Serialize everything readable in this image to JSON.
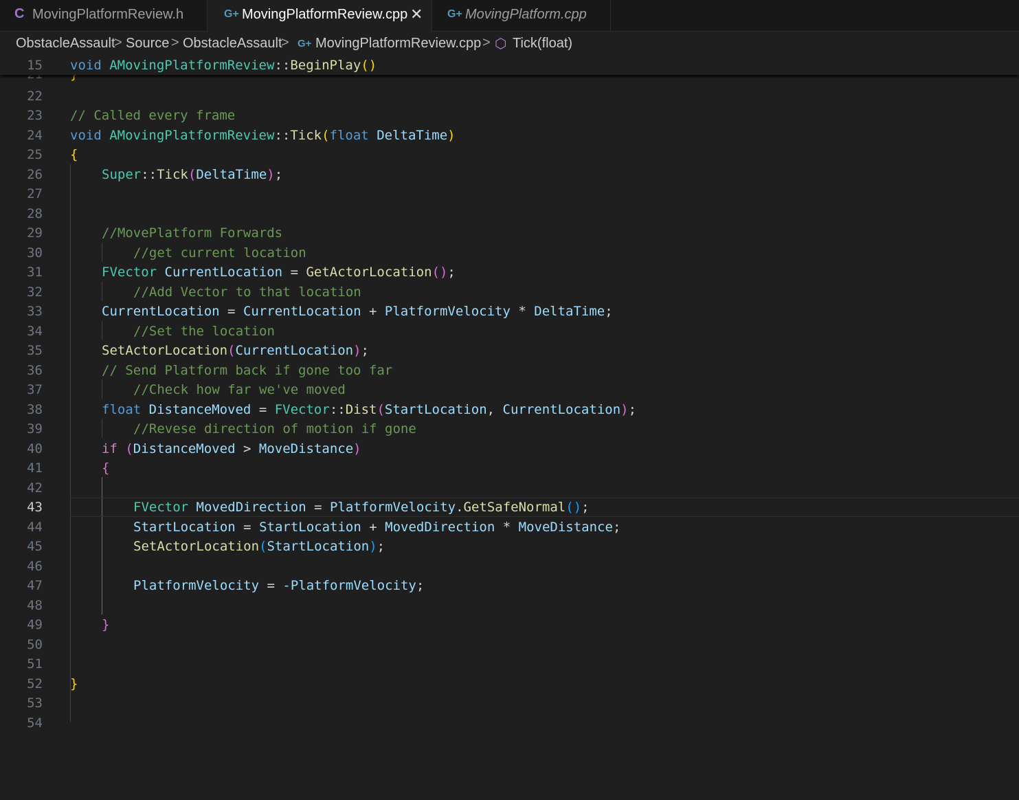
{
  "tabs": [
    {
      "label": "MovingPlatformReview.h",
      "icon": "C",
      "icon_name": "c-header-icon",
      "active": false
    },
    {
      "label": "MovingPlatformReview.cpp",
      "icon": "G+",
      "icon_name": "cpp-file-icon",
      "active": true,
      "close": "✕"
    },
    {
      "label": "MovingPlatform.cpp",
      "icon": "G+",
      "icon_name": "cpp-file-icon",
      "active": false
    }
  ],
  "breadcrumb": {
    "items": [
      "ObstacleAssault",
      "Source",
      "ObstacleAssault",
      "MovingPlatformReview.cpp",
      "Tick(float)"
    ],
    "separator": ">"
  },
  "editor": {
    "current_line": "43",
    "sticky": {
      "number": "15",
      "t1": "void",
      "t2": "AMovingPlatformReview",
      "t3": "::",
      "t4": "BeginPlay",
      "t5": "()"
    },
    "partial_line": {
      "number": "21",
      "text": "}"
    },
    "lines": [
      {
        "number": "22"
      },
      {
        "number": "23",
        "t1": "// Called every frame"
      },
      {
        "number": "24",
        "t1": "void",
        "t2": "AMovingPlatformReview",
        "t3": "::",
        "t4": "Tick",
        "t5": "(",
        "t6": "float",
        "t7": "DeltaTime",
        "t8": ")"
      },
      {
        "number": "25",
        "t1": "{"
      },
      {
        "number": "26",
        "t1": "Super",
        "t2": "::",
        "t3": "Tick",
        "t4": "(",
        "t5": "DeltaTime",
        "t6": ")",
        "t7": ";"
      },
      {
        "number": "27"
      },
      {
        "number": "28"
      },
      {
        "number": "29",
        "t1": "//MovePlatform Forwards"
      },
      {
        "number": "30",
        "t1": "//get current location"
      },
      {
        "number": "31",
        "t1": "FVector",
        "t2": "CurrentLocation",
        "t3": "=",
        "t4": "GetActorLocation",
        "t5": "()",
        "t6": ";"
      },
      {
        "number": "32",
        "t1": "//Add Vector to that location"
      },
      {
        "number": "33",
        "t1": "CurrentLocation",
        "t2": "=",
        "t3": "CurrentLocation",
        "t4": "+",
        "t5": "PlatformVelocity",
        "t6": "*",
        "t7": "DeltaTime",
        "t8": ";"
      },
      {
        "number": "34",
        "t1": "//Set the location"
      },
      {
        "number": "35",
        "t1": "SetActorLocation",
        "t2": "(",
        "t3": "CurrentLocation",
        "t4": ")",
        "t5": ";"
      },
      {
        "number": "36",
        "t1": "// Send Platform back if gone too far"
      },
      {
        "number": "37",
        "t1": "//Check how far we've moved"
      },
      {
        "number": "38",
        "t1": "float",
        "t2": "DistanceMoved",
        "t3": "=",
        "t4": "FVector",
        "t5": "::",
        "t6": "Dist",
        "t7": "(",
        "t8": "StartLocation",
        "t9": ",",
        "t10": "CurrentLocation",
        "t11": ")",
        "t12": ";"
      },
      {
        "number": "39",
        "t1": "//Revese direction of motion if gone"
      },
      {
        "number": "40",
        "t1": "if",
        "t2": "(",
        "t3": "DistanceMoved",
        "t4": ">",
        "t5": "MoveDistance",
        "t6": ")"
      },
      {
        "number": "41",
        "t1": "{"
      },
      {
        "number": "42"
      },
      {
        "number": "43",
        "t1": "FVector",
        "t2": "MovedDirection",
        "t3": "=",
        "t4": "PlatformVelocity",
        "t5": ".",
        "t6": "GetSafeNormal",
        "t7": "()",
        "t8": ";"
      },
      {
        "number": "44",
        "t1": "StartLocation",
        "t2": "=",
        "t3": "StartLocation",
        "t4": "+",
        "t5": "MovedDirection",
        "t6": "*",
        "t7": "MoveDistance",
        "t8": ";"
      },
      {
        "number": "45",
        "t1": "SetActorLocation",
        "t2": "(",
        "t3": "StartLocation",
        "t4": ")",
        "t5": ";"
      },
      {
        "number": "46"
      },
      {
        "number": "47",
        "t1": "PlatformVelocity",
        "t2": "=",
        "t3": "-PlatformVelocity",
        "t4": ";"
      },
      {
        "number": "48"
      },
      {
        "number": "49",
        "t1": "}"
      },
      {
        "number": "50"
      },
      {
        "number": "51"
      },
      {
        "number": "52",
        "t1": "}"
      },
      {
        "number": "53"
      },
      {
        "number": "54"
      }
    ]
  },
  "colors": {
    "background": "#1f1f1f",
    "keyword": "#569cd6",
    "type": "#4ec9b0",
    "function": "#dcdcaa",
    "variable": "#9cdcfe",
    "comment": "#6a9955",
    "bracket_gold": "#ffd700",
    "bracket_pink": "#da70d6",
    "bracket_blue": "#179fff"
  }
}
